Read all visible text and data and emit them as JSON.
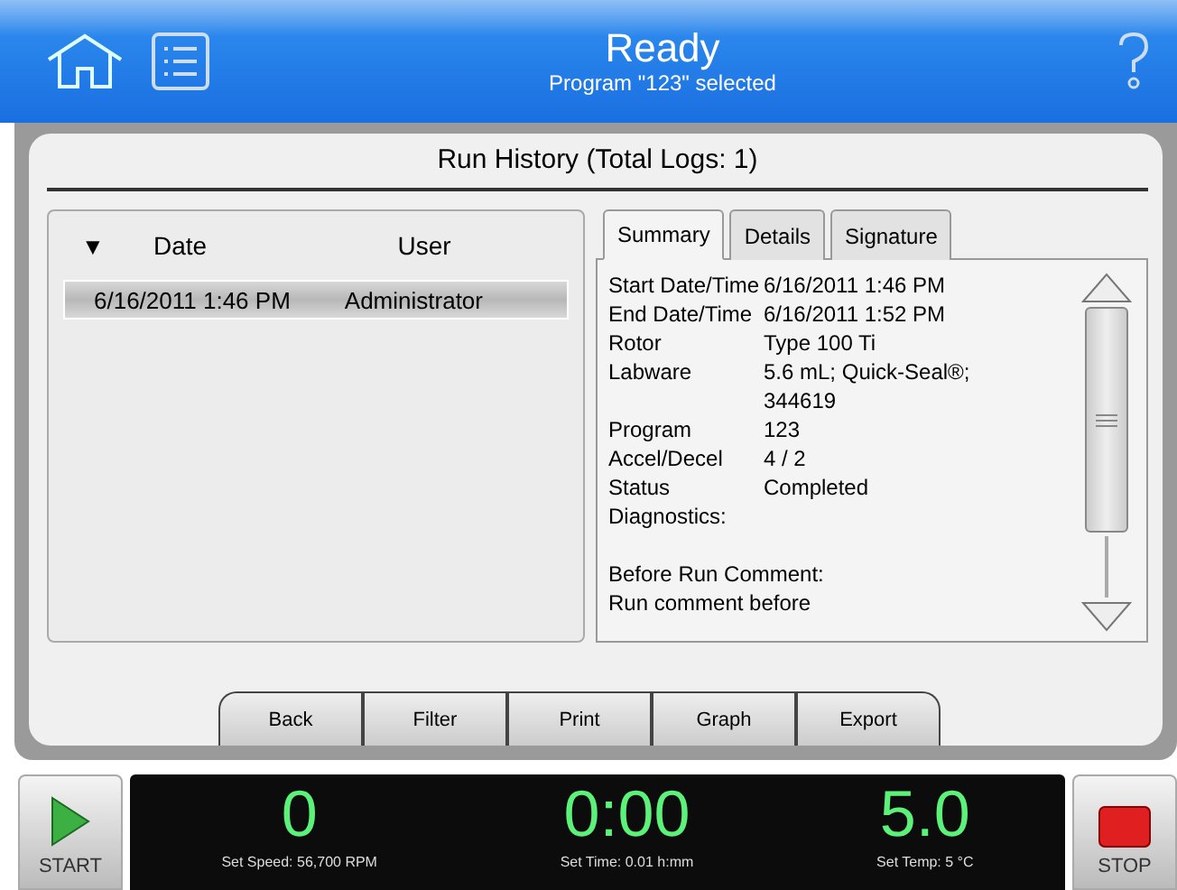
{
  "header": {
    "title": "Ready",
    "subtitle": "Program \"123\" selected"
  },
  "panel_title": "Run History (Total Logs: 1)",
  "log_table": {
    "sort_indicator": "▼",
    "columns": [
      "Date",
      "User"
    ],
    "rows": [
      {
        "date": "6/16/2011 1:46 PM",
        "user": "Administrator",
        "selected": true
      }
    ]
  },
  "tabs": [
    {
      "label": "Summary",
      "selected": true
    },
    {
      "label": "Details",
      "selected": false
    },
    {
      "label": "Signature",
      "selected": false
    }
  ],
  "summary": [
    {
      "label": "Start Date/Time",
      "value": "6/16/2011 1:46 PM"
    },
    {
      "label": "End Date/Time",
      "value": "6/16/2011 1:52 PM"
    },
    {
      "label": "Rotor",
      "value": "Type 100 Ti"
    },
    {
      "label": "Labware",
      "value": "5.6 mL; Quick-Seal®;"
    },
    {
      "value": "344619"
    },
    {
      "label": "Program",
      "value": "123"
    },
    {
      "label": "Accel/Decel",
      "value": "4 / 2"
    },
    {
      "label": "Status",
      "value": "Completed"
    },
    {
      "label": "Diagnostics:"
    }
  ],
  "comments": [
    "Before Run Comment:",
    "Run comment before"
  ],
  "actions": [
    "Back",
    "Filter",
    "Print",
    "Graph",
    "Export"
  ],
  "start_label": "START",
  "stop_label": "STOP",
  "readouts": [
    {
      "value": "0",
      "caption": "Set Speed: 56,700 RPM"
    },
    {
      "value": "0:00",
      "caption": "Set Time: 0.01 h:mm"
    },
    {
      "value": "5.0",
      "caption": "Set Temp: 5 °C"
    }
  ]
}
